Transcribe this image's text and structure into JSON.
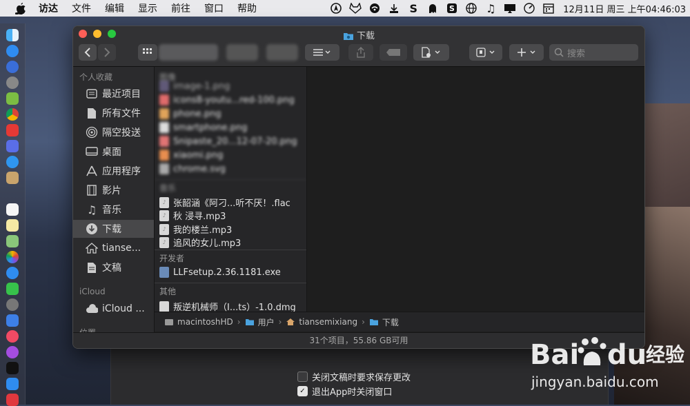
{
  "menubar": {
    "items": [
      "访达",
      "文件",
      "编辑",
      "显示",
      "前往",
      "窗口",
      "帮助"
    ],
    "clock": "12月11日 周三 上午04:46:03"
  },
  "window": {
    "title": "下载",
    "search_placeholder": "搜索"
  },
  "sidebar": {
    "favorites_header": "个人收藏",
    "items": [
      {
        "label": "最近项目",
        "icon": "recents-icon"
      },
      {
        "label": "所有文件",
        "icon": "document-icon"
      },
      {
        "label": "隔空投送",
        "icon": "airdrop-icon"
      },
      {
        "label": "桌面",
        "icon": "desktop-icon"
      },
      {
        "label": "应用程序",
        "icon": "applications-icon"
      },
      {
        "label": "影片",
        "icon": "film-icon"
      },
      {
        "label": "音乐",
        "icon": "music-icon"
      },
      {
        "label": "下载",
        "icon": "download-icon"
      },
      {
        "label": "tianse...",
        "icon": "home-icon"
      },
      {
        "label": "文稿",
        "icon": "document-icon"
      }
    ],
    "icloud_header": "iCloud",
    "icloud_item": "iCloud ...",
    "locations_header": "位置"
  },
  "recents": {
    "images_header": "图像",
    "blurred_files": [
      "image-1.png",
      "icons8-youtu...red-100.png",
      "phone.png",
      "smartphone.png",
      "Snipaste_20...12-07-20.png",
      "xiaomi.png",
      "chrome.svg"
    ],
    "music_header": "音乐",
    "music_files": [
      "张韶涵《阿刁...听不厌！.flac",
      "秋 浸寻.mp3",
      "我的楼兰.mp3",
      "追风的女儿.mp3"
    ],
    "developer_header": "开发者",
    "developer_files": [
      "LLFsetup.2.36.1181.exe"
    ],
    "other_header": "其他",
    "other_files": [
      "叛逆机械师（I...ts）-1.0.dmg"
    ]
  },
  "pathbar": [
    "macintoshHD",
    "用户",
    "tiansemixiang",
    "下载"
  ],
  "status": "31个项目，55.86 GB可用",
  "prefs": {
    "option1": "关闭文稿时要求保存更改",
    "option1_checked": false,
    "option2": "退出App时关闭窗口",
    "option2_checked": true
  },
  "watermark": {
    "logo": "Bai du 经验",
    "url": "jingyan.baidu.com"
  },
  "colors": {
    "window_bg": "#1e1e1e",
    "sidebar_bg": "#2b2b2d",
    "selection": "#48484a",
    "folder_blue": "#4aa3df"
  }
}
